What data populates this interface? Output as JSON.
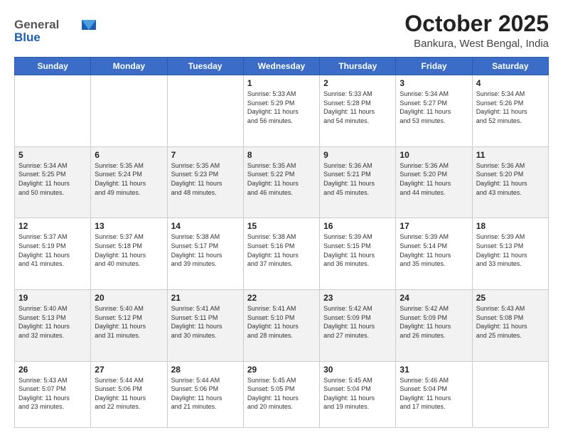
{
  "header": {
    "logo_general": "General",
    "logo_blue": "Blue",
    "month_title": "October 2025",
    "location": "Bankura, West Bengal, India"
  },
  "weekdays": [
    "Sunday",
    "Monday",
    "Tuesday",
    "Wednesday",
    "Thursday",
    "Friday",
    "Saturday"
  ],
  "weeks": [
    [
      {
        "day": "",
        "info": ""
      },
      {
        "day": "",
        "info": ""
      },
      {
        "day": "",
        "info": ""
      },
      {
        "day": "1",
        "info": "Sunrise: 5:33 AM\nSunset: 5:29 PM\nDaylight: 11 hours\nand 56 minutes."
      },
      {
        "day": "2",
        "info": "Sunrise: 5:33 AM\nSunset: 5:28 PM\nDaylight: 11 hours\nand 54 minutes."
      },
      {
        "day": "3",
        "info": "Sunrise: 5:34 AM\nSunset: 5:27 PM\nDaylight: 11 hours\nand 53 minutes."
      },
      {
        "day": "4",
        "info": "Sunrise: 5:34 AM\nSunset: 5:26 PM\nDaylight: 11 hours\nand 52 minutes."
      }
    ],
    [
      {
        "day": "5",
        "info": "Sunrise: 5:34 AM\nSunset: 5:25 PM\nDaylight: 11 hours\nand 50 minutes."
      },
      {
        "day": "6",
        "info": "Sunrise: 5:35 AM\nSunset: 5:24 PM\nDaylight: 11 hours\nand 49 minutes."
      },
      {
        "day": "7",
        "info": "Sunrise: 5:35 AM\nSunset: 5:23 PM\nDaylight: 11 hours\nand 48 minutes."
      },
      {
        "day": "8",
        "info": "Sunrise: 5:35 AM\nSunset: 5:22 PM\nDaylight: 11 hours\nand 46 minutes."
      },
      {
        "day": "9",
        "info": "Sunrise: 5:36 AM\nSunset: 5:21 PM\nDaylight: 11 hours\nand 45 minutes."
      },
      {
        "day": "10",
        "info": "Sunrise: 5:36 AM\nSunset: 5:20 PM\nDaylight: 11 hours\nand 44 minutes."
      },
      {
        "day": "11",
        "info": "Sunrise: 5:36 AM\nSunset: 5:20 PM\nDaylight: 11 hours\nand 43 minutes."
      }
    ],
    [
      {
        "day": "12",
        "info": "Sunrise: 5:37 AM\nSunset: 5:19 PM\nDaylight: 11 hours\nand 41 minutes."
      },
      {
        "day": "13",
        "info": "Sunrise: 5:37 AM\nSunset: 5:18 PM\nDaylight: 11 hours\nand 40 minutes."
      },
      {
        "day": "14",
        "info": "Sunrise: 5:38 AM\nSunset: 5:17 PM\nDaylight: 11 hours\nand 39 minutes."
      },
      {
        "day": "15",
        "info": "Sunrise: 5:38 AM\nSunset: 5:16 PM\nDaylight: 11 hours\nand 37 minutes."
      },
      {
        "day": "16",
        "info": "Sunrise: 5:39 AM\nSunset: 5:15 PM\nDaylight: 11 hours\nand 36 minutes."
      },
      {
        "day": "17",
        "info": "Sunrise: 5:39 AM\nSunset: 5:14 PM\nDaylight: 11 hours\nand 35 minutes."
      },
      {
        "day": "18",
        "info": "Sunrise: 5:39 AM\nSunset: 5:13 PM\nDaylight: 11 hours\nand 33 minutes."
      }
    ],
    [
      {
        "day": "19",
        "info": "Sunrise: 5:40 AM\nSunset: 5:13 PM\nDaylight: 11 hours\nand 32 minutes."
      },
      {
        "day": "20",
        "info": "Sunrise: 5:40 AM\nSunset: 5:12 PM\nDaylight: 11 hours\nand 31 minutes."
      },
      {
        "day": "21",
        "info": "Sunrise: 5:41 AM\nSunset: 5:11 PM\nDaylight: 11 hours\nand 30 minutes."
      },
      {
        "day": "22",
        "info": "Sunrise: 5:41 AM\nSunset: 5:10 PM\nDaylight: 11 hours\nand 28 minutes."
      },
      {
        "day": "23",
        "info": "Sunrise: 5:42 AM\nSunset: 5:09 PM\nDaylight: 11 hours\nand 27 minutes."
      },
      {
        "day": "24",
        "info": "Sunrise: 5:42 AM\nSunset: 5:09 PM\nDaylight: 11 hours\nand 26 minutes."
      },
      {
        "day": "25",
        "info": "Sunrise: 5:43 AM\nSunset: 5:08 PM\nDaylight: 11 hours\nand 25 minutes."
      }
    ],
    [
      {
        "day": "26",
        "info": "Sunrise: 5:43 AM\nSunset: 5:07 PM\nDaylight: 11 hours\nand 23 minutes."
      },
      {
        "day": "27",
        "info": "Sunrise: 5:44 AM\nSunset: 5:06 PM\nDaylight: 11 hours\nand 22 minutes."
      },
      {
        "day": "28",
        "info": "Sunrise: 5:44 AM\nSunset: 5:06 PM\nDaylight: 11 hours\nand 21 minutes."
      },
      {
        "day": "29",
        "info": "Sunrise: 5:45 AM\nSunset: 5:05 PM\nDaylight: 11 hours\nand 20 minutes."
      },
      {
        "day": "30",
        "info": "Sunrise: 5:45 AM\nSunset: 5:04 PM\nDaylight: 11 hours\nand 19 minutes."
      },
      {
        "day": "31",
        "info": "Sunrise: 5:46 AM\nSunset: 5:04 PM\nDaylight: 11 hours\nand 17 minutes."
      },
      {
        "day": "",
        "info": ""
      }
    ]
  ]
}
